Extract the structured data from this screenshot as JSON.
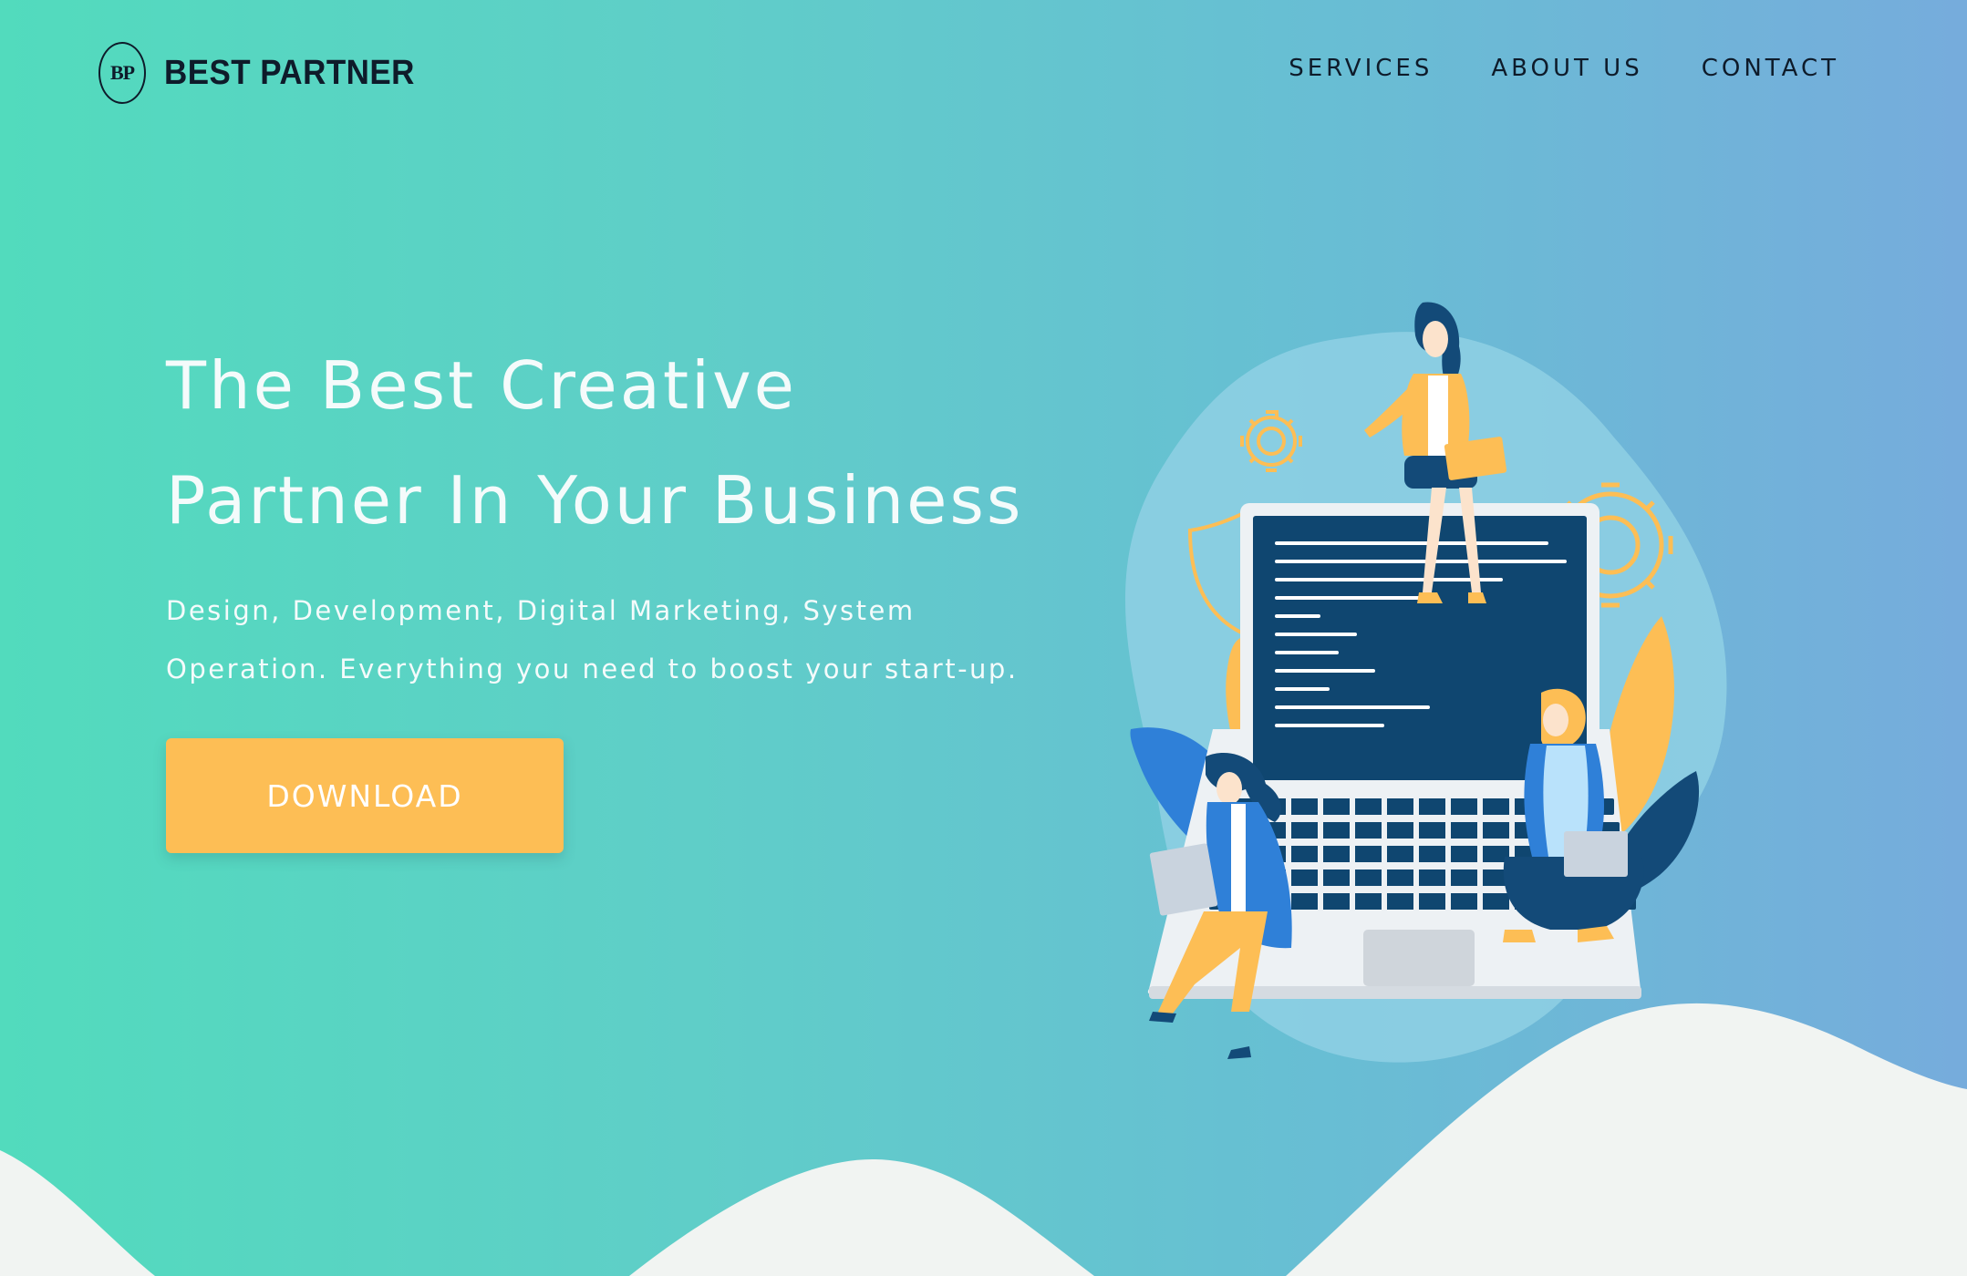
{
  "header": {
    "logo_badge": "BP",
    "logo_text": "BEST PARTNER",
    "nav": [
      {
        "label": "SERVICES"
      },
      {
        "label": "ABOUT US"
      },
      {
        "label": "CONTACT"
      }
    ]
  },
  "hero": {
    "title_line1": "The Best Creative",
    "title_line2": "Partner In Your Business",
    "subtitle_line1": "Design, Development, Digital Marketing, System",
    "subtitle_line2": "Operation. Everything you need to boost your start-up.",
    "button_label": "DOWNLOAD"
  },
  "colors": {
    "gradient_start": "#52dbbd",
    "gradient_end": "#76acdc",
    "accent_yellow": "#fdbe55",
    "text_dark": "#0e1b2a",
    "text_light": "#f4fbfb",
    "hill_color": "#f1f4f2",
    "navy": "#0f4670",
    "blue": "#2f80d8"
  },
  "icons": {
    "gear": "gear-icon",
    "shield": "shield-icon"
  }
}
